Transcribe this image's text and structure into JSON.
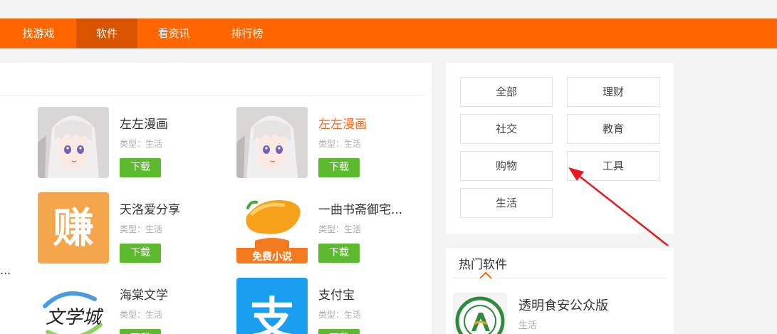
{
  "nav": {
    "items": [
      {
        "label": "找游戏",
        "active": false
      },
      {
        "label": "软件",
        "active": true
      },
      {
        "label": "看资讯",
        "active": false
      },
      {
        "label": "排行榜",
        "active": false
      }
    ]
  },
  "apps": [
    {
      "name": "左左漫画",
      "type": "类型：生活",
      "download": "下载",
      "icon": "anime-girl-icon"
    },
    {
      "name": "左左漫画",
      "type": "类型：生活",
      "download": "下载",
      "icon": "anime-girl-icon"
    },
    {
      "name": "天洛爱分享",
      "type": "类型：生活",
      "download": "下载",
      "icon": "zhuan-icon"
    },
    {
      "name": "一曲书斋御宅...",
      "type": "类型：生活",
      "download": "下载",
      "icon": "mango-novel-icon"
    },
    {
      "name": "海棠文学",
      "type": "类型：生活",
      "download": "下载",
      "icon": "wenxuecheng-icon"
    },
    {
      "name": "支付宝",
      "type": "类型：生活",
      "download": "下载",
      "icon": "alipay-icon"
    }
  ],
  "left_cutoff_text": "...",
  "icon_texts": {
    "zhuan": "赚",
    "mango_banner": "免费小说",
    "wenxuecheng": "文学城",
    "alipay": "支"
  },
  "categories": [
    "全部",
    "理财",
    "社交",
    "教育",
    "购物",
    "工具",
    "生活"
  ],
  "hot": {
    "title": "热门软件",
    "item": {
      "name": "透明食安公众版",
      "type": "生活"
    }
  },
  "colors": {
    "brand": "#ff6600",
    "nav_active": "#d95400",
    "download": "#5dba2f",
    "highlight_name": "#f06a1d",
    "annotation_arrow": "#e8171b"
  }
}
